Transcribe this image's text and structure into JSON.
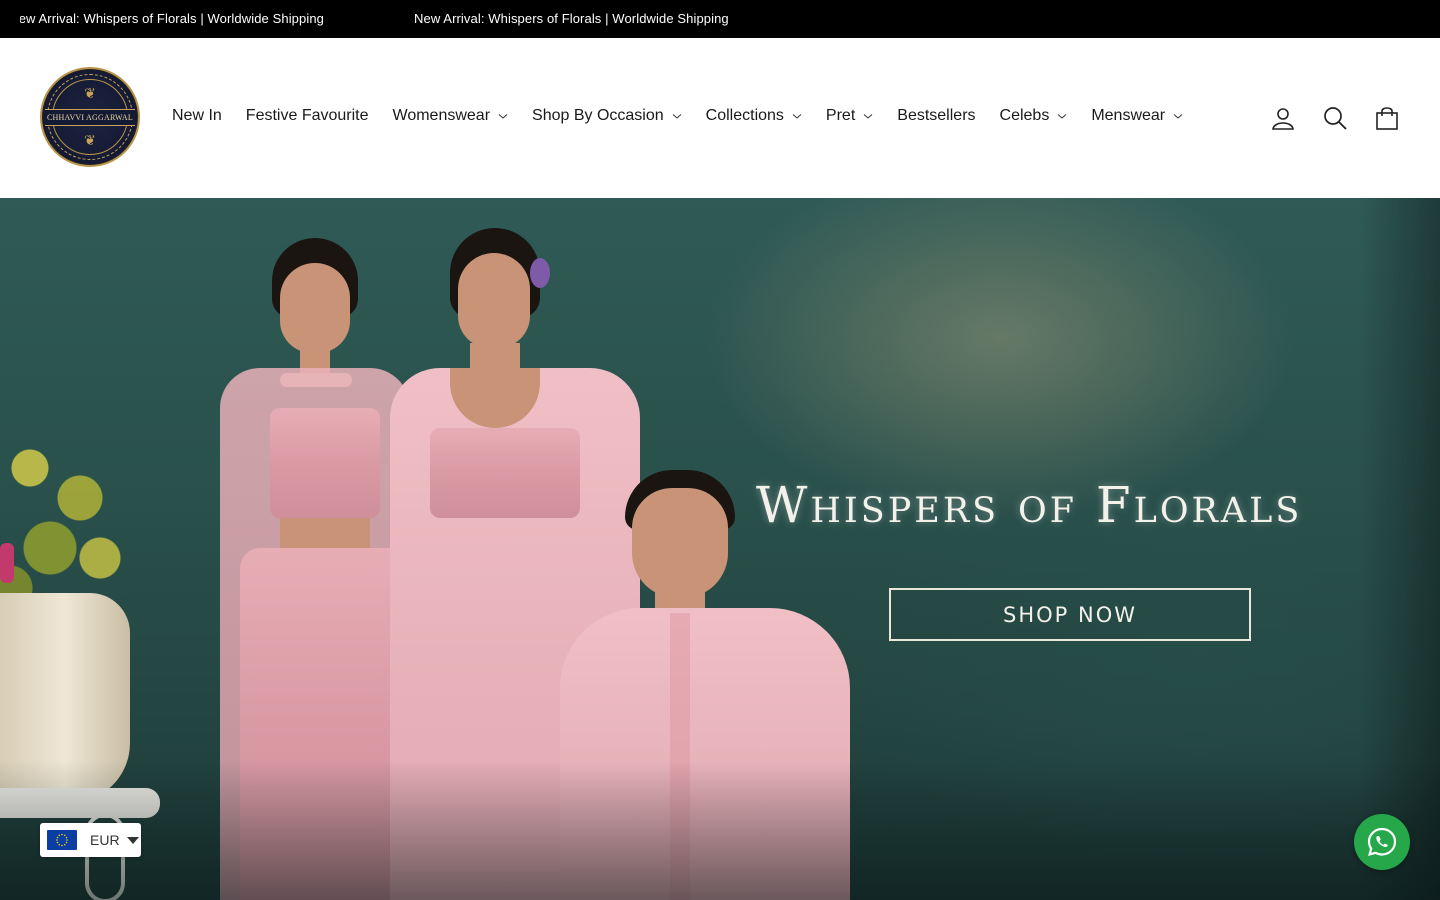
{
  "announcement": {
    "messages": [
      "New Arrival: Whispers of Florals | Worldwide Shipping",
      "New Arrival: Whispers of Florals | Worldwide Shipping"
    ]
  },
  "header": {
    "logo_text": "CHHAVVI AGGARWAL",
    "nav": [
      {
        "label": "New In",
        "has_dropdown": false
      },
      {
        "label": "Festive Favourite",
        "has_dropdown": false
      },
      {
        "label": "Womenswear",
        "has_dropdown": true
      },
      {
        "label": "Shop By Occasion",
        "has_dropdown": true
      },
      {
        "label": "Collections",
        "has_dropdown": true
      },
      {
        "label": "Pret",
        "has_dropdown": true
      },
      {
        "label": "Bestsellers",
        "has_dropdown": false
      },
      {
        "label": "Celebs",
        "has_dropdown": true
      },
      {
        "label": "Menswear",
        "has_dropdown": true
      }
    ],
    "icons": [
      "account-icon",
      "search-icon",
      "cart-icon"
    ]
  },
  "hero": {
    "title": "Whispers of Florals",
    "cta_label": "SHOP NOW"
  },
  "currency": {
    "code": "EUR",
    "flag_icon": "eu-flag-icon"
  },
  "colors": {
    "announcement_bg": "#000000",
    "hero_bg": "#2a514c",
    "whatsapp": "#25a74a"
  }
}
